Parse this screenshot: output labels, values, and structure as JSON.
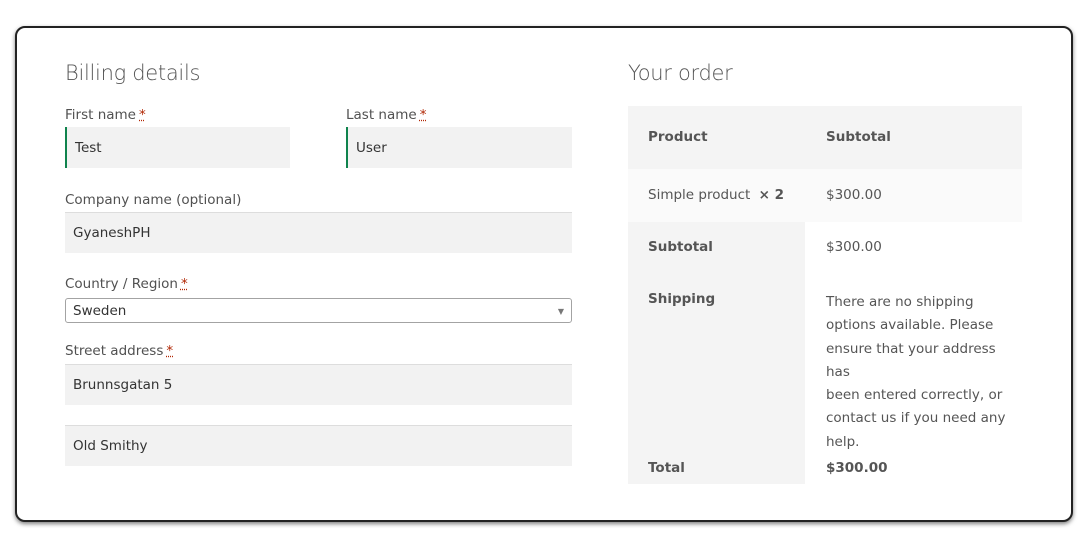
{
  "billing": {
    "heading": "Billing details",
    "required_mark": "*",
    "first_name_label": "First name",
    "first_name_value": "Test",
    "last_name_label": "Last name",
    "last_name_value": "User",
    "company_label": "Company name (optional)",
    "company_value": "GyaneshPH",
    "country_label": "Country / Region",
    "country_value": "Sweden",
    "street_label": "Street address",
    "street_line1_value": "Brunnsgatan 5",
    "street_line2_value": "Old Smithy"
  },
  "order": {
    "heading": "Your order",
    "header_product": "Product",
    "header_subtotal": "Subtotal",
    "item_name": "Simple product",
    "item_qty": "× 2",
    "item_price": "$300.00",
    "subtotal_label": "Subtotal",
    "subtotal_value": "$300.00",
    "shipping_label": "Shipping",
    "shipping_lines": [
      "There are no shipping",
      "options available. Please",
      "ensure that your address has",
      "been entered correctly, or",
      "contact us if you need any",
      "help."
    ],
    "total_label": "Total",
    "total_value": "$300.00"
  },
  "colors": {
    "accent_border": "#0f834d",
    "required": "#b12704",
    "field_bg": "#f2f2f2"
  }
}
